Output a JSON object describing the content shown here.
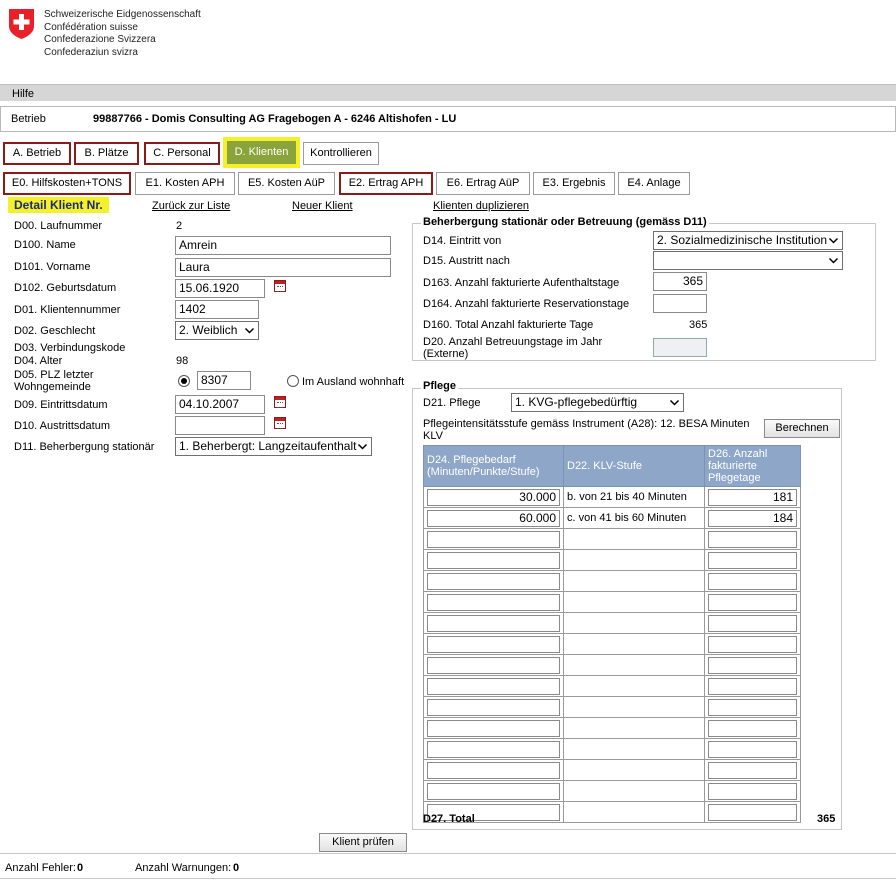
{
  "header": {
    "gov_lines": [
      "Schweizerische Eidgenossenschaft",
      "Confédération suisse",
      "Confederazione Svizzera",
      "Confederaziun svizra"
    ]
  },
  "menu": {
    "hilfe": "Hilfe"
  },
  "betrieb": {
    "label": "Betrieb",
    "value": "99887766 -  Domis Consulting AG Fragebogen A -  6246  Altishofen -  LU"
  },
  "tabs_main": [
    "A. Betrieb",
    "B. Plätze",
    "C. Personal",
    "D. Klienten",
    "Kontrollieren"
  ],
  "tabs_sub": [
    "E0. Hilfskosten+TONS",
    "E1. Kosten APH",
    "E5. Kosten AüP",
    "E2. Ertrag APH",
    "E6. Ertrag AüP",
    "E3. Ergebnis",
    "E4. Anlage"
  ],
  "detail": {
    "title": "Detail Klient Nr.",
    "links": [
      "Zurück zur Liste",
      "Neuer Klient",
      "Klienten duplizieren"
    ]
  },
  "left": {
    "d00_label": "D00. Laufnummer",
    "d00_value": "2",
    "d100_label": "D100. Name",
    "d100_value": "Amrein",
    "d101_label": "D101. Vorname",
    "d101_value": "Laura",
    "d102_label": "D102. Geburtsdatum",
    "d102_value": "15.06.1920",
    "d01_label": "D01. Klientennummer",
    "d01_value": "1402",
    "d02_label": "D02. Geschlecht",
    "d02_value": "2. Weiblich",
    "d03_label": "D03. Verbindungskode",
    "d04_label": "D04. Alter",
    "d04_value": "98",
    "d05_label": "D05. PLZ letzter Wohngemeinde",
    "d05_value": "8307",
    "d05_ausland": "Im Ausland wohnhaft",
    "d09_label": "D09. Eintrittsdatum",
    "d09_value": "04.10.2007",
    "d10_label": "D10. Austrittsdatum",
    "d10_value": "",
    "d11_label": "D11. Beherbergung stationär",
    "d11_value": "1. Beherbergt: Langzeitaufenthalt"
  },
  "beherbergung": {
    "legend": "Beherbergung stationär oder Betreuung (gemäss D11)",
    "d14_label": "D14. Eintritt von",
    "d14_value": "2. Sozialmedizinische Institution",
    "d15_label": "D15. Austritt nach",
    "d15_value": "",
    "d163_label": "D163. Anzahl fakturierte Aufenthaltstage",
    "d163_value": "365",
    "d164_label": "D164. Anzahl fakturierte Reservationstage",
    "d164_value": "",
    "d160_label": "D160. Total Anzahl fakturierte Tage",
    "d160_value": "365",
    "d20_label": "D20. Anzahl Betreuungstage im Jahr (Externe)",
    "d20_value": ""
  },
  "pflege": {
    "legend": "Pflege",
    "d21_label": "D21. Pflege",
    "d21_value": "1. KVG-pflegebedürftig",
    "instrument": "Pflegeintensitätsstufe gemäss Instrument (A28): 12. BESA Minuten KLV",
    "berechnen": "Berechnen",
    "col1": "D24. Pflegebedarf (Minuten/Punkte/Stufe)",
    "col2": "D22. KLV-Stufe",
    "col3": "D26. Anzahl fakturierte Pflegetage",
    "rows": [
      {
        "bedarf": "30.000",
        "stufe": "b. von 21 bis 40 Minuten",
        "tage": "181"
      },
      {
        "bedarf": "60.000",
        "stufe": "c. von 41 bis 60 Minuten",
        "tage": "184"
      },
      {
        "bedarf": "",
        "stufe": "",
        "tage": ""
      },
      {
        "bedarf": "",
        "stufe": "",
        "tage": ""
      },
      {
        "bedarf": "",
        "stufe": "",
        "tage": ""
      },
      {
        "bedarf": "",
        "stufe": "",
        "tage": ""
      },
      {
        "bedarf": "",
        "stufe": "",
        "tage": ""
      },
      {
        "bedarf": "",
        "stufe": "",
        "tage": ""
      },
      {
        "bedarf": "",
        "stufe": "",
        "tage": ""
      },
      {
        "bedarf": "",
        "stufe": "",
        "tage": ""
      },
      {
        "bedarf": "",
        "stufe": "",
        "tage": ""
      },
      {
        "bedarf": "",
        "stufe": "",
        "tage": ""
      },
      {
        "bedarf": "",
        "stufe": "",
        "tage": ""
      },
      {
        "bedarf": "",
        "stufe": "",
        "tage": ""
      },
      {
        "bedarf": "",
        "stufe": "",
        "tage": ""
      },
      {
        "bedarf": "",
        "stufe": "",
        "tage": ""
      }
    ],
    "d27_label": "D27. Total",
    "d27_value": "365"
  },
  "actions": {
    "pruefen": "Klient prüfen"
  },
  "footer": {
    "fehler_label": "Anzahl Fehler:",
    "fehler_value": "0",
    "warnungen_label": "Anzahl Warnungen:",
    "warnungen_value": "0"
  },
  "colors": {
    "accent_active": "#8aa33a",
    "highlight": "#f4f12a",
    "tab_red": "#8b1a1a",
    "table_header": "#8ea7c8"
  }
}
